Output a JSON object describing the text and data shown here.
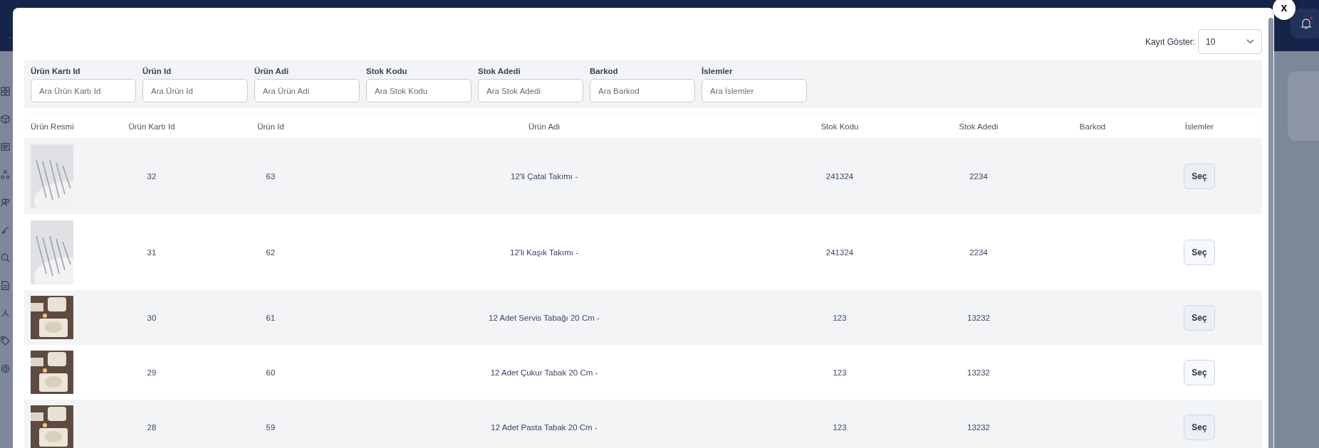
{
  "page_size": {
    "label": "Kayıt Göster:",
    "value": "10"
  },
  "filters": [
    {
      "label": "Ürün Kartı Id",
      "placeholder": "Ara Ürün Kartı Id"
    },
    {
      "label": "Ürün Id",
      "placeholder": "Ara Ürün Id"
    },
    {
      "label": "Ürün Adi",
      "placeholder": "Ara Ürün Adi"
    },
    {
      "label": "Stok Kodu",
      "placeholder": "Ara Stok Kodu"
    },
    {
      "label": "Stok Adedi",
      "placeholder": "Ara Stok Adedi"
    },
    {
      "label": "Barkod",
      "placeholder": "Ara Barkod"
    },
    {
      "label": "İslemler",
      "placeholder": "Ara İslemler"
    }
  ],
  "table": {
    "columns": [
      "Ürün Resmi",
      "Ürün Kartı Id",
      "Ürün Id",
      "Ürün Adi",
      "Stok Kodu",
      "Stok Adedi",
      "Barkod",
      "İslemler"
    ],
    "rows": [
      {
        "kind": "cutlery",
        "card_id": "32",
        "product_id": "63",
        "name": "12'li Çatal Takımı -",
        "stock_code": "241324",
        "stock_qty": "2234",
        "action": "Seç"
      },
      {
        "kind": "cutlery",
        "card_id": "31",
        "product_id": "62",
        "name": "12'li Kaşık Takımı -",
        "stock_code": "241324",
        "stock_qty": "2234",
        "action": "Seç"
      },
      {
        "kind": "tableware",
        "card_id": "30",
        "product_id": "61",
        "name": "12 Adet Servis Tabağı 20 Cm -",
        "stock_code": "123",
        "stock_qty": "13232",
        "action": "Seç"
      },
      {
        "kind": "tableware",
        "card_id": "29",
        "product_id": "60",
        "name": "12 Adet Çukur Tabak 20 Cm -",
        "stock_code": "123",
        "stock_qty": "13232",
        "action": "Seç"
      },
      {
        "kind": "tableware",
        "card_id": "28",
        "product_id": "59",
        "name": "12 Adet Pasta Tabak 20 Cm -",
        "stock_code": "123",
        "stock_qty": "13232",
        "action": "Seç"
      }
    ]
  },
  "close": "x"
}
